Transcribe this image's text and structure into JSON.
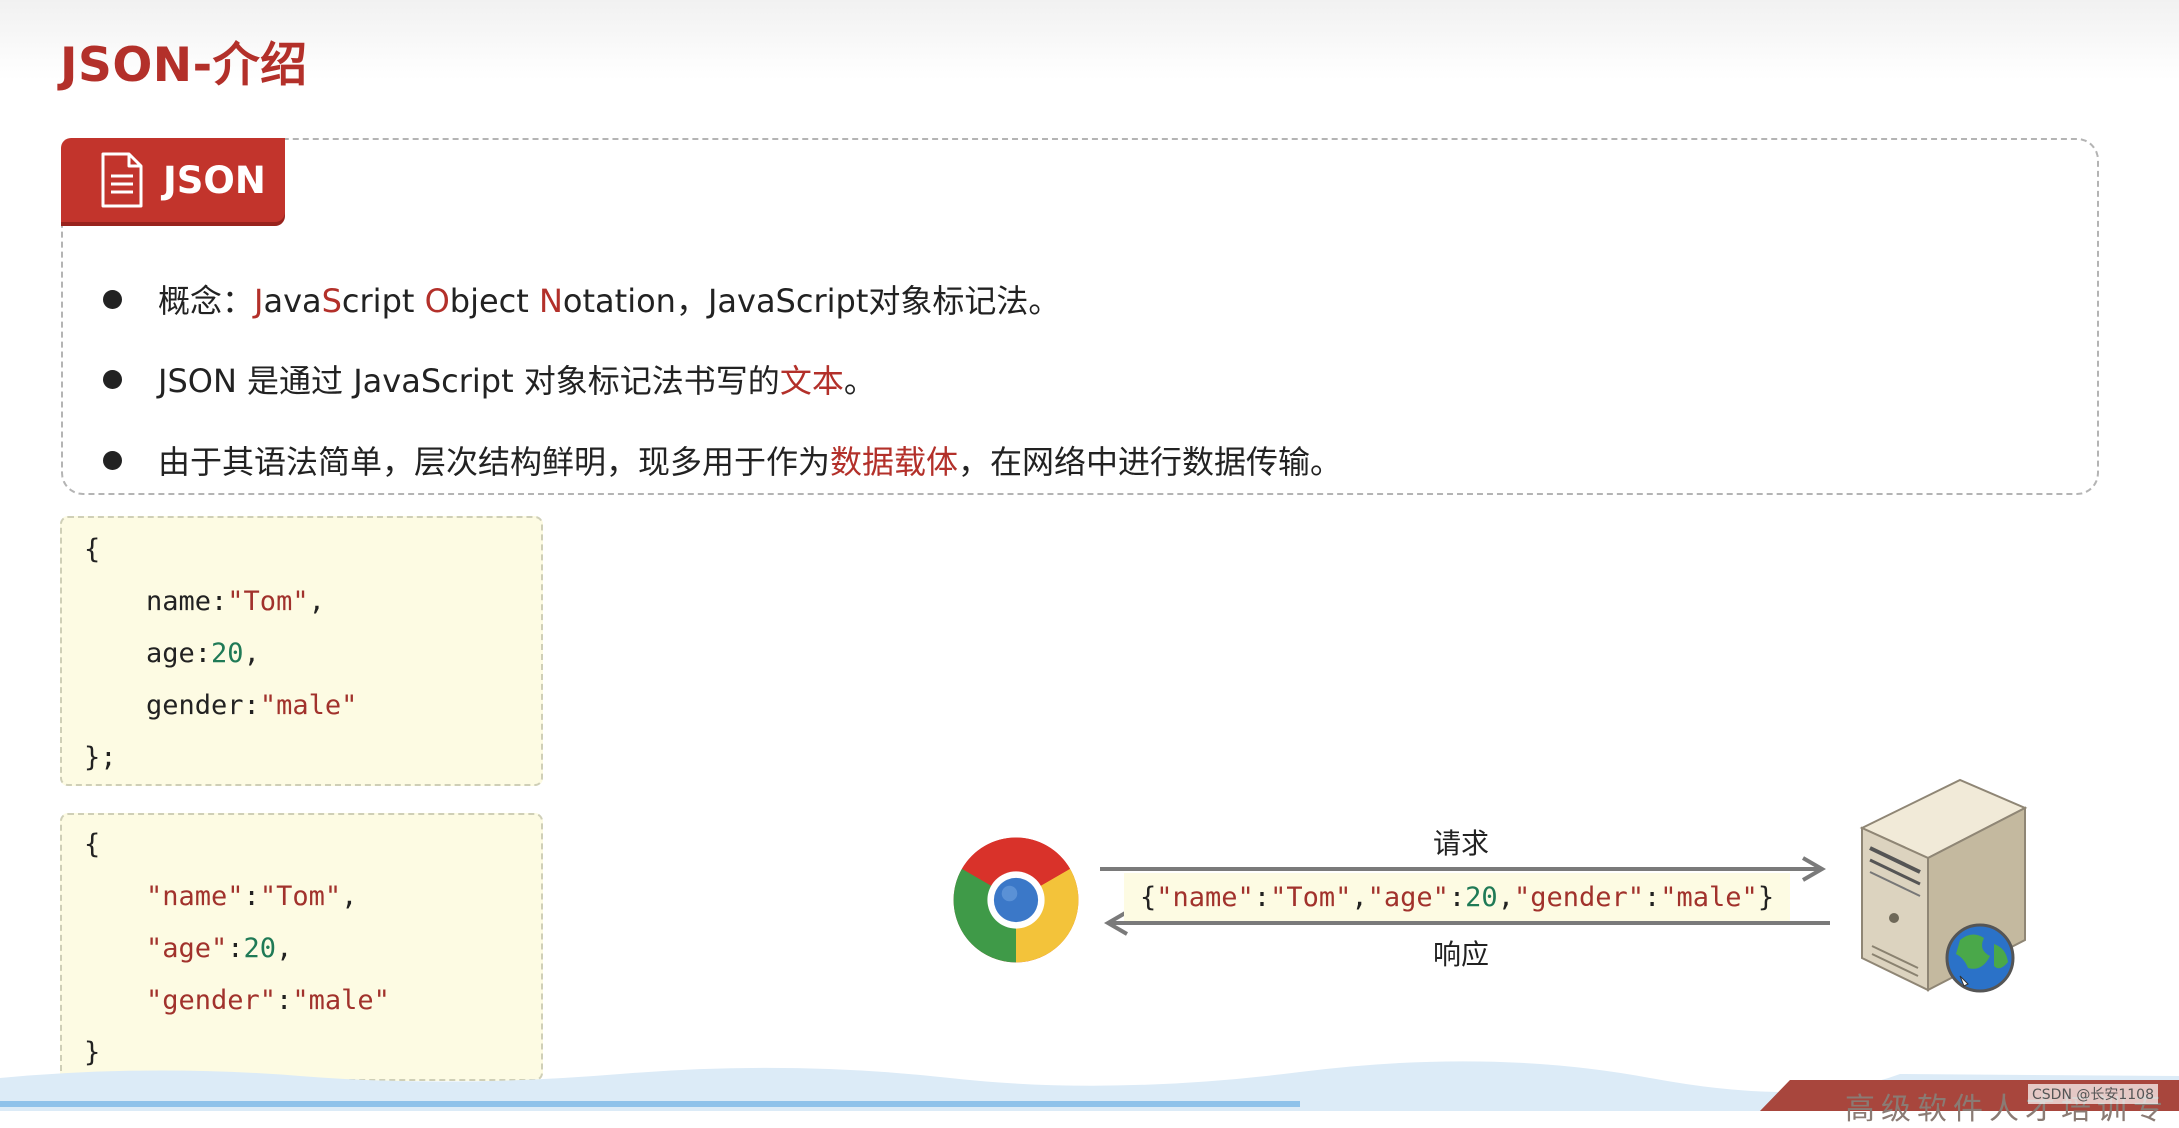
{
  "page": {
    "title": "JSON-介绍"
  },
  "concept_card": {
    "tab_label": "JSON",
    "bullets": [
      {
        "label": "概念：",
        "j": "J",
        "ava": "ava",
        "s": "S",
        "cript": "cript ",
        "o": "O",
        "bject": "bject ",
        "n": "N",
        "otation": "otation",
        "rest": "，JavaScript对象标记法。"
      },
      {
        "before": "JSON 是通过 JavaScript 对象标记法书写的",
        "highlight": "文本",
        "after": "。"
      },
      {
        "before": "由于其语法简单，层次结构鲜明，现多用于作为",
        "highlight": "数据载体",
        "after": "，在网络中进行数据传输。"
      }
    ]
  },
  "js_object_example": {
    "open": "{",
    "lines": [
      {
        "key": "name",
        "sep": ":",
        "value": "\"Tom\"",
        "end": ","
      },
      {
        "key": "age",
        "sep": ":",
        "value": "20",
        "end": ","
      },
      {
        "key": "gender",
        "sep": ":",
        "value": "\"male\"",
        "end": ""
      }
    ],
    "close": "};"
  },
  "json_example": {
    "open": "{",
    "lines": [
      {
        "key": "\"name\"",
        "sep": ":",
        "value": "\"Tom\"",
        "end": ","
      },
      {
        "key": "\"age\"",
        "sep": ":",
        "value": "20",
        "end": ","
      },
      {
        "key": "\"gender\"",
        "sep": ":",
        "value": "\"male\"",
        "end": ""
      }
    ],
    "close": "}"
  },
  "diagram": {
    "request_label": "请求",
    "response_label": "响应",
    "payload": {
      "p1": "{",
      "k1": "\"name\"",
      "c1": ":",
      "v1": "\"Tom\"",
      "m1": ",",
      "k2": "\"age\"",
      "c2": ":",
      "v2": "20",
      "m2": ",",
      "k3": "\"gender\"",
      "c3": ":",
      "v3": "\"male\"",
      "p2": "}"
    },
    "browser_icon": "chrome-icon",
    "server_icon": "server-icon"
  },
  "footer": {
    "slogan": "高级软件人才培训专",
    "watermark": "CSDN @长安1108"
  },
  "colors": {
    "accent": "#b3302a",
    "tab_bg": "#c2342c",
    "code_bg": "#fdfbe3",
    "number": "#1f7a56"
  }
}
